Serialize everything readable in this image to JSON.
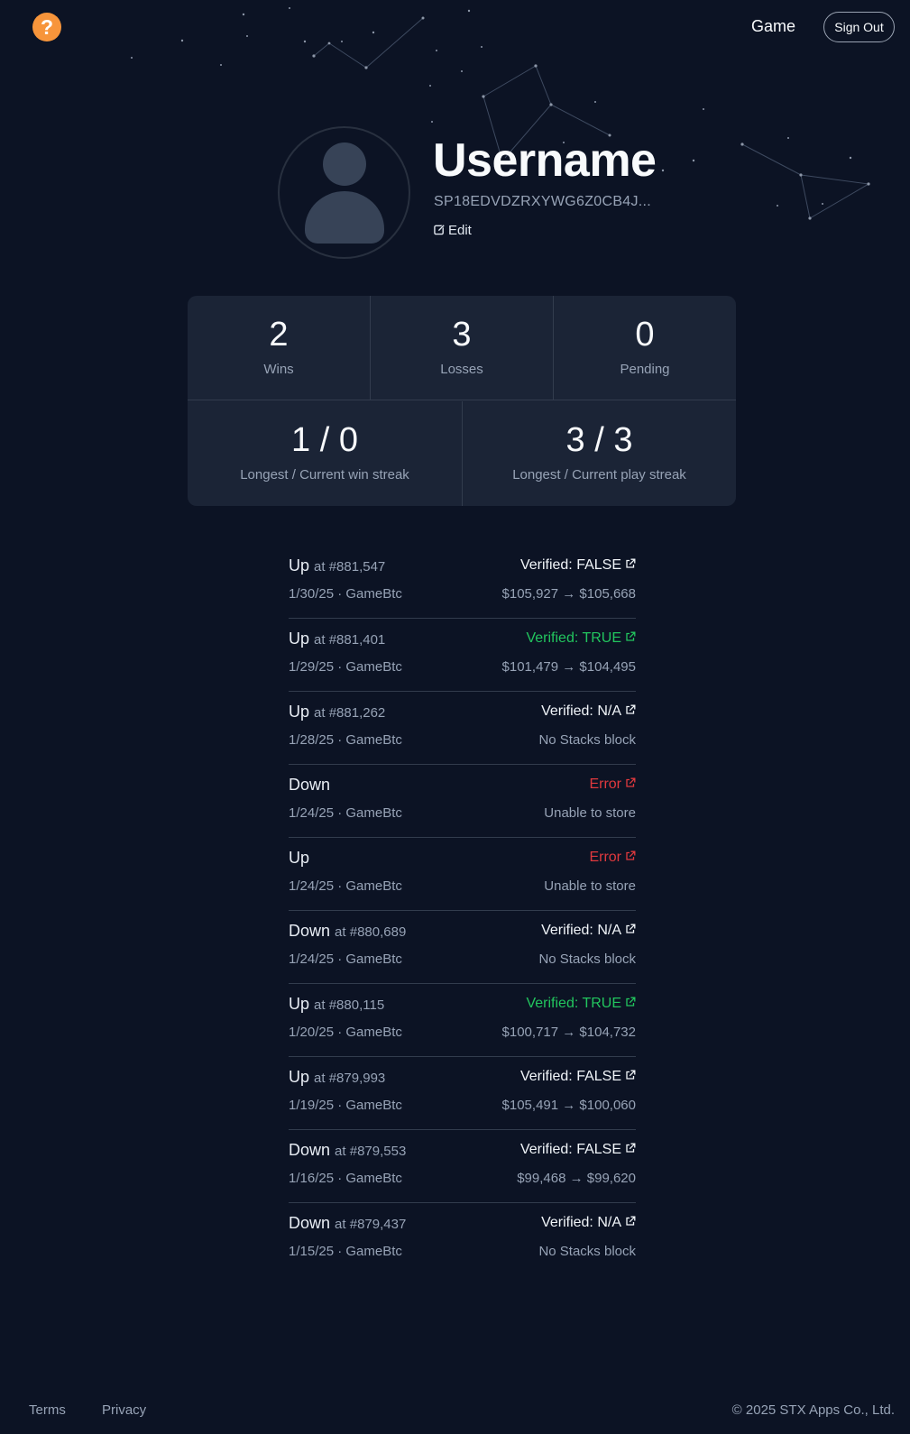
{
  "header": {
    "logo_glyph": "?",
    "nav_game": "Game",
    "signout_label": "Sign Out"
  },
  "profile": {
    "username": "Username",
    "address": "SP18EDVDZRXYWG6Z0CB4J...",
    "edit_label": "Edit"
  },
  "stats": {
    "wins": {
      "value": "2",
      "label": "Wins"
    },
    "losses": {
      "value": "3",
      "label": "Losses"
    },
    "pending": {
      "value": "0",
      "label": "Pending"
    },
    "win_streak": {
      "value": "1 / 0",
      "label": "Longest / Current win streak"
    },
    "play_streak": {
      "value": "3 / 3",
      "label": "Longest / Current play streak"
    }
  },
  "games": [
    {
      "direction": "Up",
      "block": "at #881,547",
      "date": "1/30/25 · GameBtc",
      "status": "Verified: FALSE",
      "status_type": "false",
      "detail": "$105,927 → $105,668"
    },
    {
      "direction": "Up",
      "block": "at #881,401",
      "date": "1/29/25 · GameBtc",
      "status": "Verified: TRUE",
      "status_type": "true",
      "detail": "$101,479 → $104,495"
    },
    {
      "direction": "Up",
      "block": "at #881,262",
      "date": "1/28/25 · GameBtc",
      "status": "Verified: N/A",
      "status_type": "na",
      "detail": "No Stacks block"
    },
    {
      "direction": "Down",
      "block": "",
      "date": "1/24/25 · GameBtc",
      "status": "Error",
      "status_type": "error",
      "detail": "Unable to store"
    },
    {
      "direction": "Up",
      "block": "",
      "date": "1/24/25 · GameBtc",
      "status": "Error",
      "status_type": "error",
      "detail": "Unable to store"
    },
    {
      "direction": "Down",
      "block": "at #880,689",
      "date": "1/24/25 · GameBtc",
      "status": "Verified: N/A",
      "status_type": "na",
      "detail": "No Stacks block"
    },
    {
      "direction": "Up",
      "block": "at #880,115",
      "date": "1/20/25 · GameBtc",
      "status": "Verified: TRUE",
      "status_type": "true",
      "detail": "$100,717 → $104,732"
    },
    {
      "direction": "Up",
      "block": "at #879,993",
      "date": "1/19/25 · GameBtc",
      "status": "Verified: FALSE",
      "status_type": "false",
      "detail": "$105,491 → $100,060"
    },
    {
      "direction": "Down",
      "block": "at #879,553",
      "date": "1/16/25 · GameBtc",
      "status": "Verified: FALSE",
      "status_type": "false",
      "detail": "$99,468 → $99,620"
    },
    {
      "direction": "Down",
      "block": "at #879,437",
      "date": "1/15/25 · GameBtc",
      "status": "Verified: N/A",
      "status_type": "na",
      "detail": "No Stacks block"
    }
  ],
  "footer": {
    "terms": "Terms",
    "privacy": "Privacy",
    "copyright": "© 2025 STX Apps Co., Ltd."
  },
  "colors": {
    "background": "#0c1324",
    "panel": "#1b2436",
    "accent_logo": "#f7953b",
    "verified_true": "#22c55e",
    "error": "#e0393e",
    "muted": "#97a3b6"
  }
}
